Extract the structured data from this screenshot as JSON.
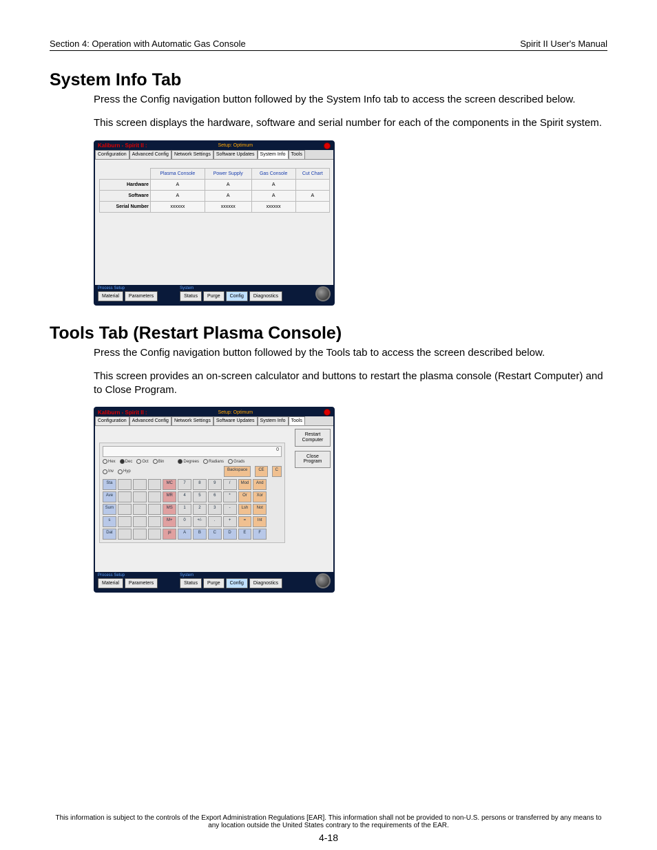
{
  "header": {
    "left": "Section 4: Operation with Automatic Gas Console",
    "right": "Spirit II User's Manual"
  },
  "sections": {
    "sysinfo": {
      "heading": "System Info Tab",
      "para1": "Press the Config navigation button followed by the System Info tab to access the screen described below.",
      "para2": "This screen displays the hardware, software and serial number for each of the components in the Spirit system."
    },
    "tools": {
      "heading": "Tools Tab (Restart Plasma Console)",
      "para1": "Press the Config navigation button followed by the Tools tab to access the screen described below.",
      "para2": "This screen provides an on-screen calculator and buttons to restart the plasma console (Restart Computer) and to Close Program."
    }
  },
  "app": {
    "title": "Kaliburn - Spirit II :",
    "subtitle": "Setup: Optimum",
    "tabs": [
      "Configuration",
      "Advanced Config",
      "Network Settings",
      "Software Updates",
      "System Info",
      "Tools"
    ],
    "nav_groups": {
      "process": "Process Setup",
      "system": "System"
    },
    "nav_buttons": {
      "material": "Material",
      "parameters": "Parameters",
      "status": "Status",
      "purge": "Purge",
      "config": "Config",
      "diagnostics": "Diagnostics"
    }
  },
  "sys_table": {
    "col_headers": [
      "Plasma Console",
      "Power Supply",
      "Gas Console",
      "Cut Chart"
    ],
    "row_labels": [
      "Hardware",
      "Software",
      "Serial Number"
    ],
    "rows": [
      [
        "A",
        "A",
        "A",
        ""
      ],
      [
        "A",
        "A",
        "A",
        "A"
      ],
      [
        "xxxxxx",
        "xxxxxx",
        "xxxxxx",
        ""
      ]
    ]
  },
  "tools_panel": {
    "restart": "Restart Computer",
    "close": "Close Program",
    "calc": {
      "display": "0",
      "modes": [
        "Hex",
        "Dec",
        "Oct",
        "Bin"
      ],
      "modes_sel": "Dec",
      "units": [
        "Degrees",
        "Radians",
        "Grads"
      ],
      "units_sel": "Degrees",
      "flags": [
        "Inv",
        "Hyp"
      ],
      "row_a": [
        "",
        "",
        "",
        "",
        "Backspace",
        "CE",
        "C"
      ],
      "keys": [
        [
          "Sta",
          "",
          "",
          "",
          "MC",
          "7",
          "8",
          "9",
          "/",
          "Mod",
          "And"
        ],
        [
          "Ave",
          "",
          "",
          "",
          "MR",
          "4",
          "5",
          "6",
          "*",
          "Or",
          "Xor"
        ],
        [
          "Sum",
          "",
          "",
          "",
          "MS",
          "1",
          "2",
          "3",
          "-",
          "Lsh",
          "Not"
        ],
        [
          "s",
          "",
          "",
          "",
          "M+",
          "0",
          "+/-",
          ".",
          "+",
          "=",
          "Int"
        ],
        [
          "Dat",
          "",
          "",
          "",
          "pi",
          "A",
          "B",
          "C",
          "D",
          "E",
          "F"
        ]
      ]
    }
  },
  "footer": "This information is subject to the controls of the Export Administration Regulations [EAR].  This information shall not be provided to non-U.S. persons or transferred by any means to any location outside the United States contrary to the requirements of the EAR.",
  "page_number": "4-18"
}
